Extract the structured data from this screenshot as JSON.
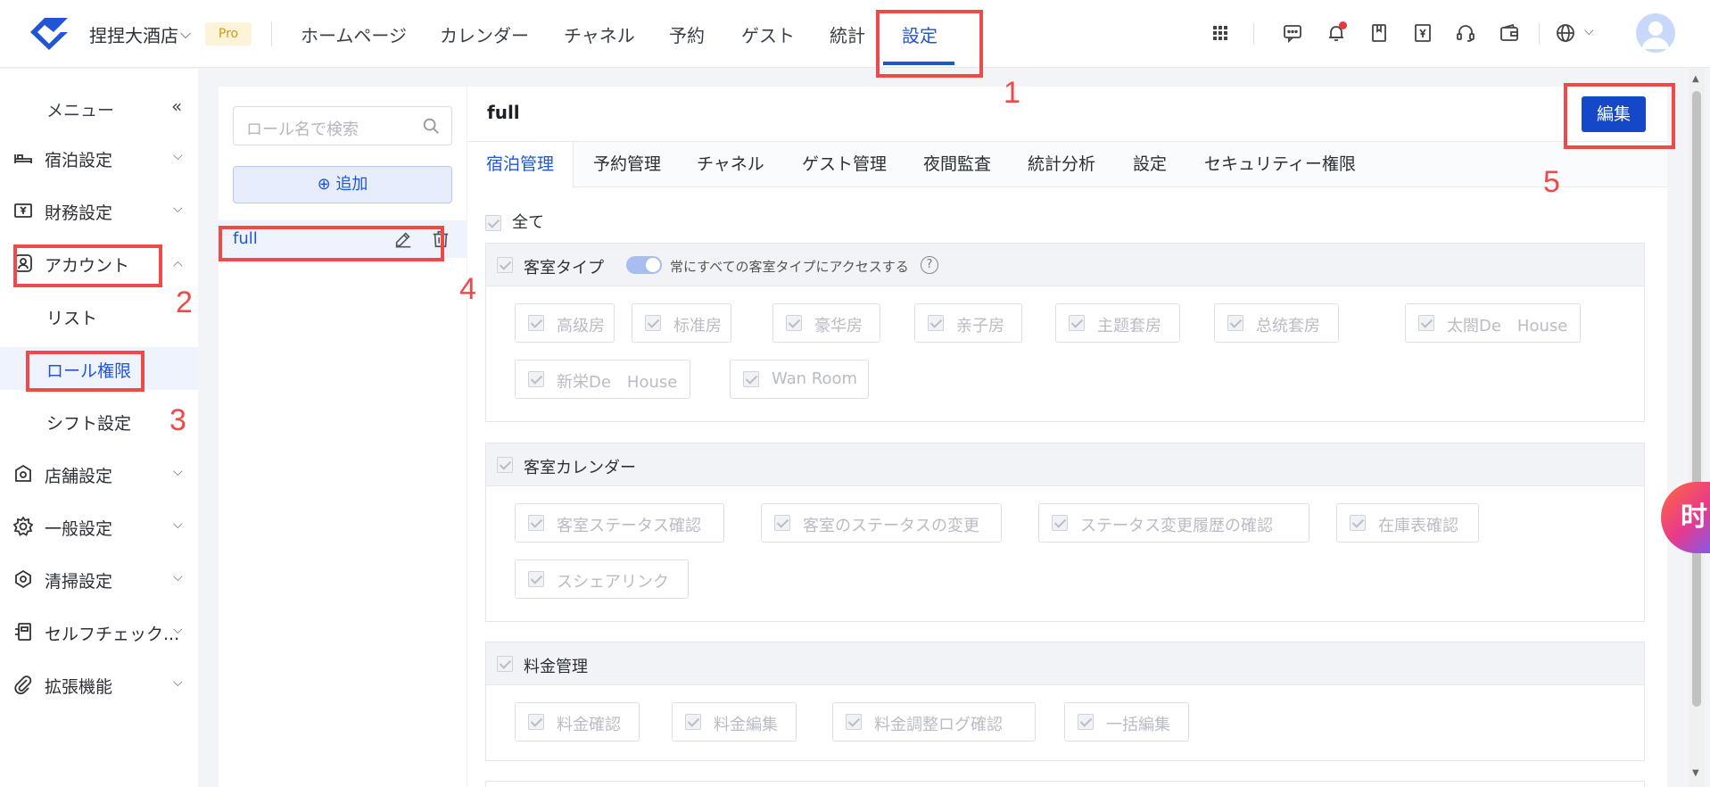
{
  "header": {
    "hotel_name": "捏捏大酒店",
    "badge": "Pro",
    "nav": [
      {
        "label": "ホームページ"
      },
      {
        "label": "カレンダー"
      },
      {
        "label": "チャネル"
      },
      {
        "label": "予約"
      },
      {
        "label": "ゲスト"
      },
      {
        "label": "統計"
      },
      {
        "label": "設定",
        "active": true
      }
    ],
    "icons": [
      "apps-grid-icon",
      "message-icon",
      "bell-icon",
      "bookmark-icon",
      "invoice-icon",
      "headset-icon",
      "wallet-icon",
      "globe-icon",
      "avatar"
    ]
  },
  "sidebar": {
    "title": "メニュー",
    "items": [
      {
        "label": "宿泊設定",
        "icon": "bed-icon"
      },
      {
        "label": "財務設定",
        "icon": "finance-icon"
      },
      {
        "label": "アカウント",
        "icon": "account-icon",
        "expanded": true
      },
      {
        "label": "店舗設定",
        "icon": "store-icon"
      },
      {
        "label": "一般設定",
        "icon": "gear-icon"
      },
      {
        "label": "清掃設定",
        "icon": "cleaning-icon"
      },
      {
        "label": "セルフチェック...",
        "icon": "self-checkin-icon"
      },
      {
        "label": "拡張機能",
        "icon": "paperclip-icon"
      }
    ],
    "account_sub": [
      {
        "label": "リスト"
      },
      {
        "label": "ロール権限",
        "active": true
      },
      {
        "label": "シフト設定"
      }
    ]
  },
  "roles": {
    "search_placeholder": "ロール名で検索",
    "add_label": "⊕ 追加",
    "list": [
      {
        "name": "full"
      }
    ]
  },
  "main": {
    "title": "full",
    "edit_label": "編集",
    "tabs": [
      {
        "label": "宿泊管理",
        "active": true
      },
      {
        "label": "予約管理"
      },
      {
        "label": "チャネル"
      },
      {
        "label": "ゲスト管理"
      },
      {
        "label": "夜間監査"
      },
      {
        "label": "統計分析"
      },
      {
        "label": "設定"
      },
      {
        "label": "セキュリティー権限"
      }
    ],
    "all_label": "全て",
    "sections": [
      {
        "title": "客室タイプ",
        "toggle_label": "常にすべての客室タイプにアクセスする",
        "toggle_on": true,
        "options": [
          "高级房",
          "标准房",
          "豪华房",
          "亲子房",
          "主题套房",
          "总统套房",
          "太閤De　House",
          "新栄De　House",
          "Wan Room"
        ]
      },
      {
        "title": "客室カレンダー",
        "options": [
          "客室ステータス確認",
          "客室のステータスの変更",
          "ステータス変更履歴の確認",
          "在庫表確認",
          "スシェアリンク"
        ]
      },
      {
        "title": "料金管理",
        "options": [
          "料金確認",
          "料金編集",
          "料金調整ログ確認",
          "一括編集"
        ]
      }
    ]
  },
  "annotations": [
    "1",
    "2",
    "3",
    "4",
    "5"
  ],
  "float_badge": "时",
  "colors": {
    "accent": "#1f56d6",
    "annotation": "#ef4a4a",
    "edit_button": "#1448c8"
  }
}
